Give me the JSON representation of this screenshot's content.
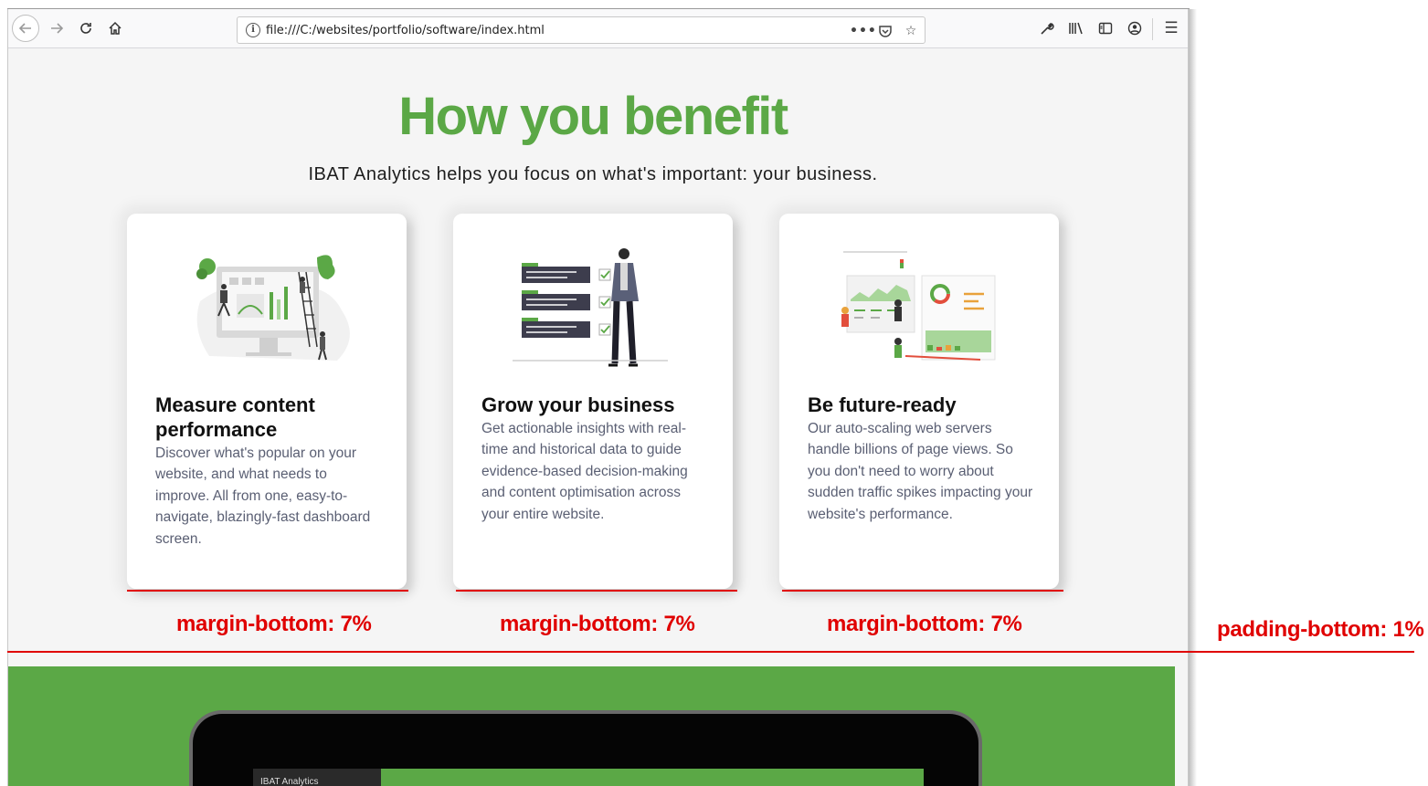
{
  "browser": {
    "url": "file:///C:/websites/portfolio/software/index.html",
    "icons": [
      "back-icon",
      "forward-icon",
      "reload-icon",
      "home-icon",
      "info-icon",
      "more-icon",
      "pocket-icon",
      "star-icon",
      "wrench-icon",
      "library-icon",
      "sidebar-icon",
      "account-icon",
      "menu-icon"
    ]
  },
  "page": {
    "heading": "How you benefit",
    "subheading": "IBAT Analytics helps you focus on what's important: your business."
  },
  "cards": [
    {
      "title": "Measure content performance",
      "text": "Discover what's popular on your website, and what needs to improve. All from one, easy-to-navigate, blazingly-fast dashboard screen."
    },
    {
      "title": "Grow your business",
      "text": "Get actionable insights with real-time and historical data to guide evidence-based decision-making and content optimisation across your entire website."
    },
    {
      "title": "Be future-ready",
      "text": "Our auto-scaling web servers handle billions of page views. So you don't need to worry about sudden traffic spikes impacting your website's performance."
    }
  ],
  "annotations": {
    "margin_label": "margin-bottom: 7%",
    "padding_label": "padding-bottom: 1%",
    "color": "#e00000"
  },
  "device": {
    "tab_text": "IBAT Analytics"
  },
  "colors": {
    "accent_green": "#5ba846",
    "annotation_red": "#e00000"
  }
}
